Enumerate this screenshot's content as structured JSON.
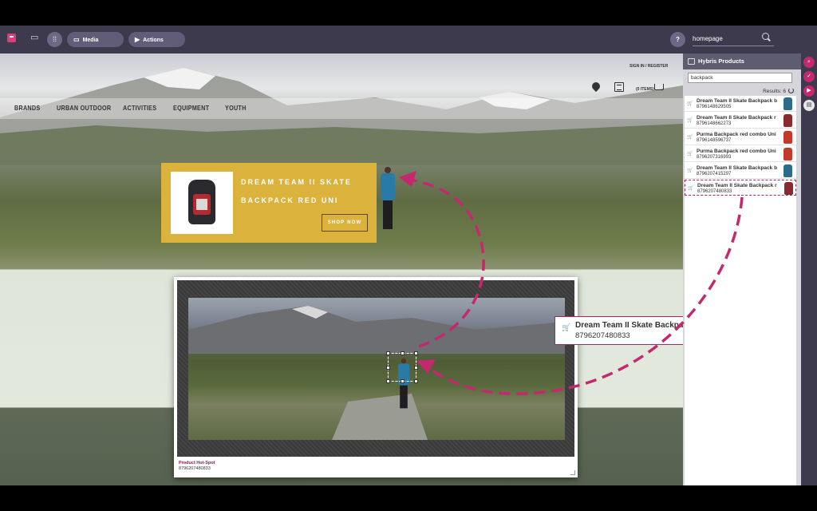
{
  "toolbar": {
    "media_label": "Media",
    "actions_label": "Actions",
    "help_label": "?",
    "search_value": "homepage",
    "accent_color": "#c4286e"
  },
  "site": {
    "signin": "SIGN IN / REGISTER",
    "cart_items": "(0 ITEMS)",
    "nav": [
      "BRANDS",
      "URBAN OUTDOOR",
      "ACTIVITIES",
      "EQUIPMENT",
      "YOUTH"
    ]
  },
  "banner": {
    "title": "DREAM TEAM II SKATE BACKPACK RED UNI",
    "cta": "SHOP NOW"
  },
  "hotspot": {
    "label": "Product Hot-Spot",
    "code": "8796207480833"
  },
  "drag_card": {
    "name": "Dream Team II Skate Backpack red Uni",
    "code": "8796207480833"
  },
  "panel": {
    "title": "Hybris Products",
    "search_value": "backpack",
    "results_label": "Results: 6",
    "items": [
      {
        "name": "Dream Team II Skate Backpack b",
        "code": "8796148629505",
        "thumb_color": "#2e6a8a"
      },
      {
        "name": "Dream Team II Skate Backpack r",
        "code": "8796148662273",
        "thumb_color": "#8a2a2e"
      },
      {
        "name": "Purma Backpack red combo Uni",
        "code": "8796148596737",
        "thumb_color": "#c43a2a"
      },
      {
        "name": "Purma Backpack red combo Uni",
        "code": "8796207316993",
        "thumb_color": "#c43a2a"
      },
      {
        "name": "Dream Team II Skate Backpack b",
        "code": "8796207415297",
        "thumb_color": "#2e6a8a"
      },
      {
        "name": "Dream Team II Skate Backpack r",
        "code": "8796207480833",
        "thumb_color": "#8a2a2e"
      }
    ]
  },
  "rail": {
    "icons": [
      "search-icon",
      "check-icon",
      "video-icon",
      "print-icon"
    ]
  }
}
